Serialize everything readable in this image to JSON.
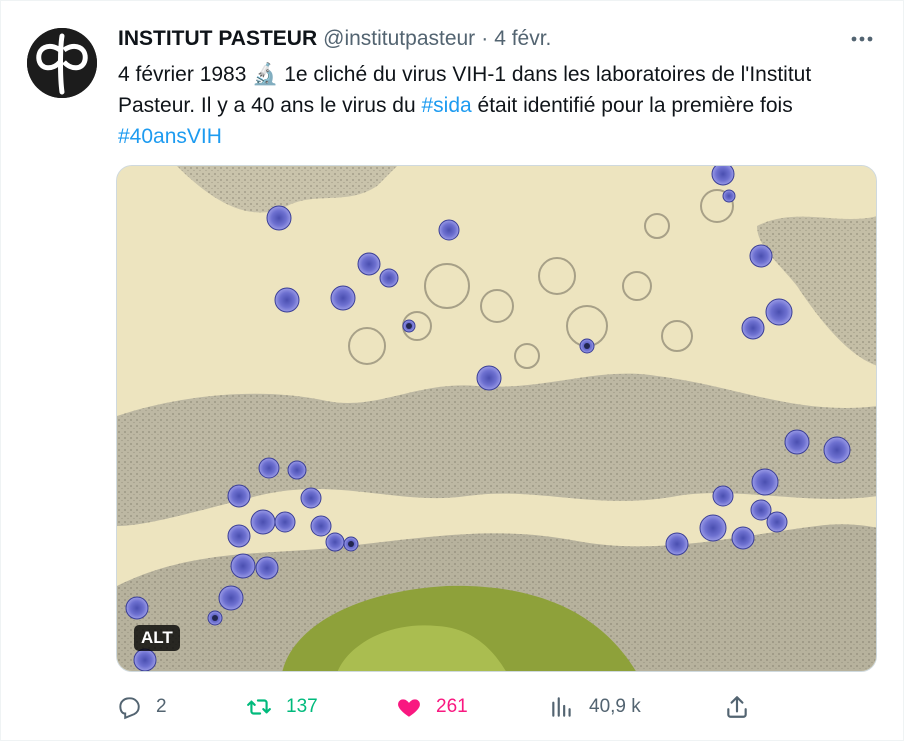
{
  "tweet": {
    "display_name": "INSTITUT PASTEUR",
    "handle": "@institutpasteur",
    "separator": "·",
    "time": "4 févr.",
    "text_part1": "4 février 1983 ",
    "microscope_emoji": "🔬",
    "text_part2": " 1e cliché du virus VIH-1 dans les laboratoires de l'Institut Pasteur. Il y a 40 ans le virus du ",
    "hashtag_sida": "#sida",
    "text_part3": " était identifié pour la première fois ",
    "hashtag_40ans": "#40ansVIH",
    "media_alt_badge": "ALT",
    "more_icon": "more-dots-icon"
  },
  "actions": {
    "replies": "2",
    "retweets": "137",
    "likes": "261",
    "views": "40,9 k",
    "liked": true
  },
  "colors": {
    "link": "#1d9bf0",
    "retweet": "#00ba7c",
    "like": "#f91880",
    "muted": "#536471"
  }
}
